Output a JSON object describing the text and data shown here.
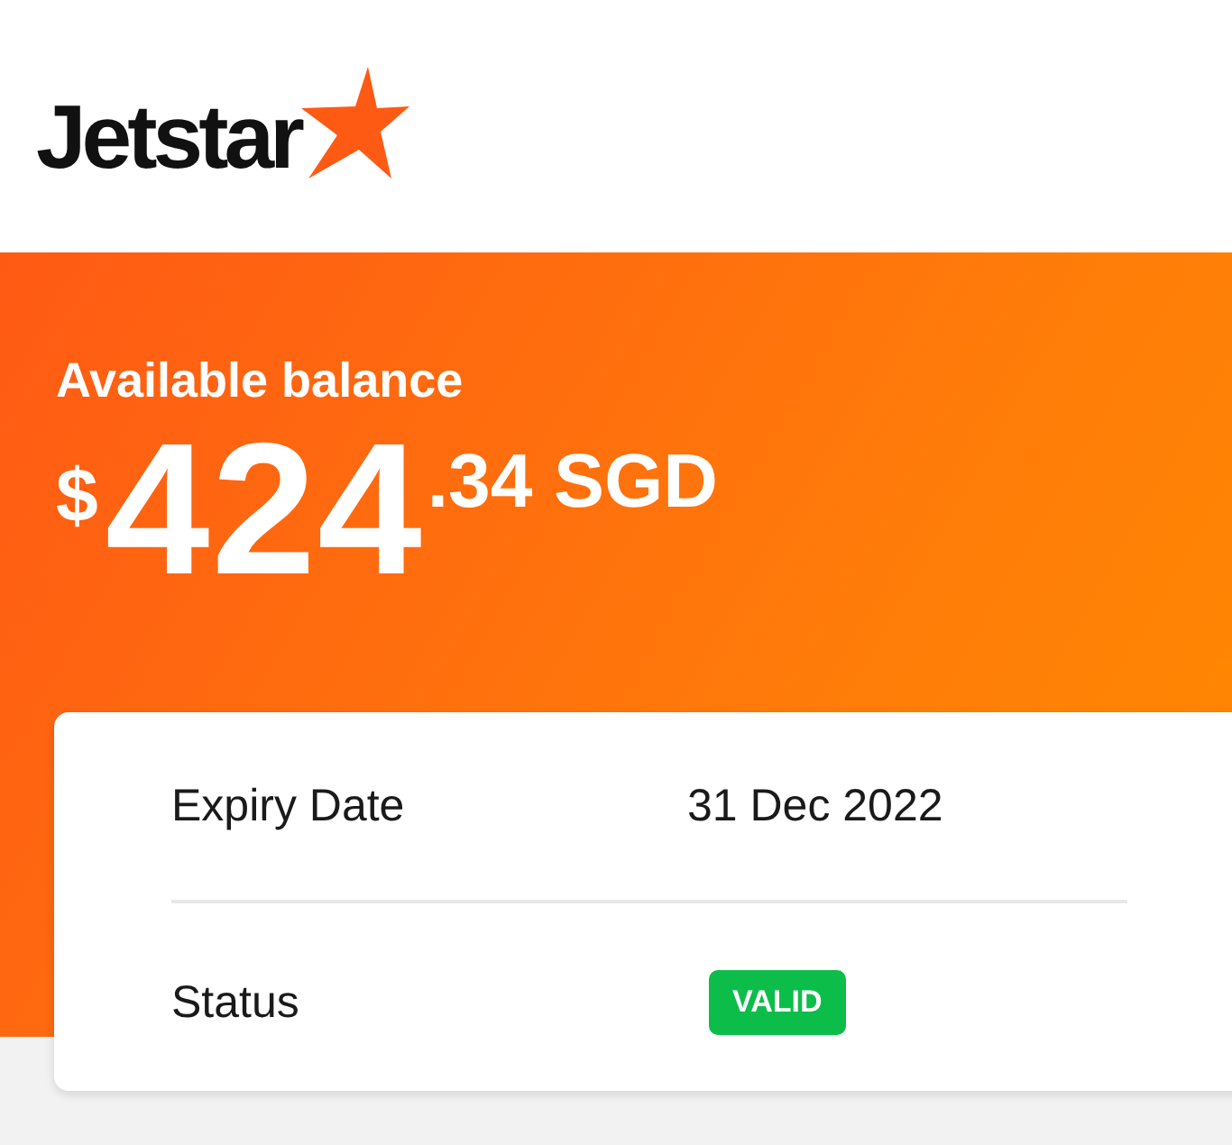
{
  "logo": {
    "text": "Jetstar"
  },
  "balance": {
    "label": "Available balance",
    "currency_symbol": "$",
    "whole": "424",
    "fraction": ".34 SGD"
  },
  "details": [
    {
      "kind": "text",
      "label": "Expiry Date",
      "value": "31 Dec 2022"
    },
    {
      "kind": "badge",
      "label": "Status",
      "value": "VALID",
      "color": "#0dbd4a"
    }
  ]
}
